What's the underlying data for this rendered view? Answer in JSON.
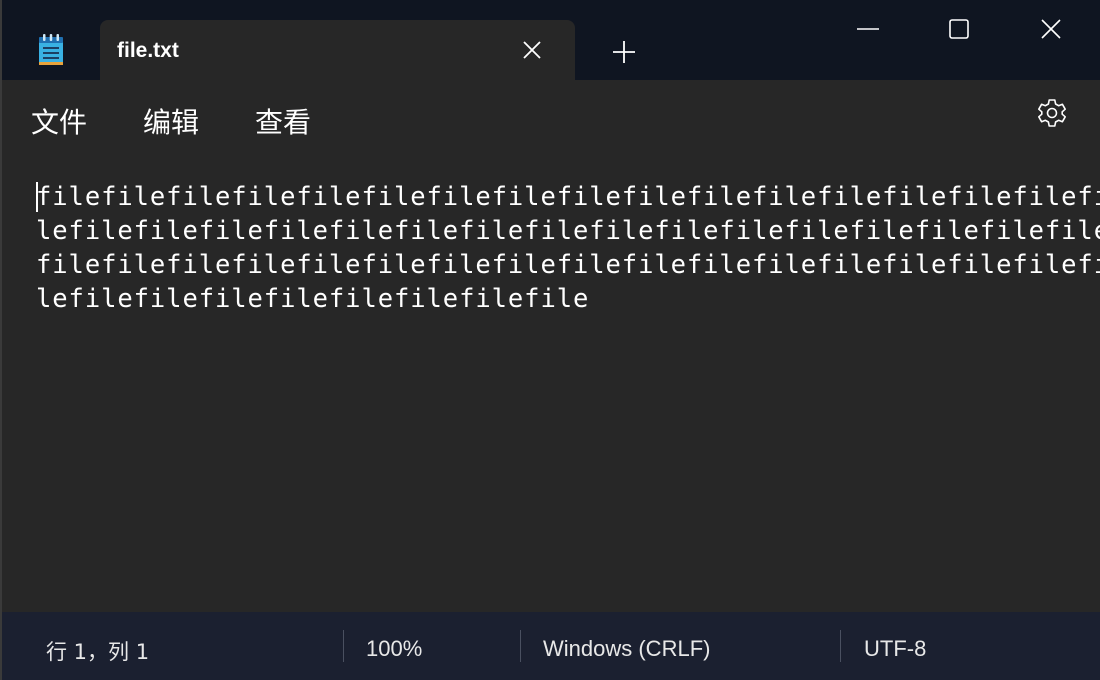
{
  "tab": {
    "title": "file.txt"
  },
  "menu": {
    "file": "文件",
    "edit": "编辑",
    "view": "查看"
  },
  "editor": {
    "lines": [
      "filefilefilefilefilefilefilefilefilefilefilefilefilefilefilefilefi",
      "lefilefilefilefilefilefilefilefilefilefilefilefilefilefilefilefile",
      "filefilefilefilefilefilefilefilefilefilefilefilefilefilefilefilefi",
      "lefilefilefilefilefilefilefilefile"
    ]
  },
  "status": {
    "position": "行 1，列 1",
    "zoom": "100%",
    "line_ending": "Windows (CRLF)",
    "encoding": "UTF-8"
  },
  "icons": {
    "app": "notepad-icon",
    "tab_close": "close-icon",
    "new_tab": "plus-icon",
    "minimize": "minimize-icon",
    "maximize": "maximize-icon",
    "close": "close-icon",
    "settings": "gear-icon"
  },
  "colors": {
    "titlebar": "#0f1521",
    "editor_bg": "#272727",
    "statusbar": "#1b2030",
    "icon_accent": "#3bb3e0"
  }
}
